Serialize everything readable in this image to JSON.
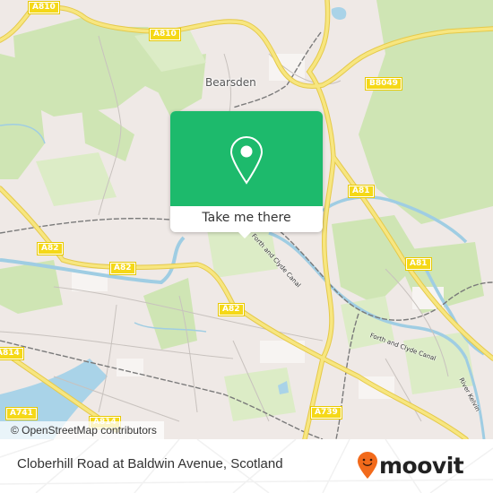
{
  "map": {
    "place_labels": [
      {
        "name": "Bearsden"
      }
    ],
    "road_labels": [
      {
        "ref": "A810"
      },
      {
        "ref": "A810"
      },
      {
        "ref": "B8049"
      },
      {
        "ref": "A81"
      },
      {
        "ref": "A81"
      },
      {
        "ref": "A82"
      },
      {
        "ref": "A82"
      },
      {
        "ref": "A82"
      },
      {
        "ref": "A814"
      },
      {
        "ref": "A741"
      },
      {
        "ref": "A739"
      },
      {
        "ref": "A814"
      }
    ],
    "water_labels": [
      {
        "name": "Forth and Clyde Canal"
      },
      {
        "name": "Forth and Clyde Canal"
      },
      {
        "name": "River Kelvin"
      }
    ],
    "attribution": "© OpenStreetMap contributors"
  },
  "popup": {
    "icon": "map-pin-icon",
    "button_label": "Take me there",
    "color": "#1dba6c"
  },
  "footer": {
    "stop_name": "Cloberhill Road at Baldwin Avenue, Scotland",
    "brand": "moovit",
    "brand_color": "#f26a1b"
  }
}
